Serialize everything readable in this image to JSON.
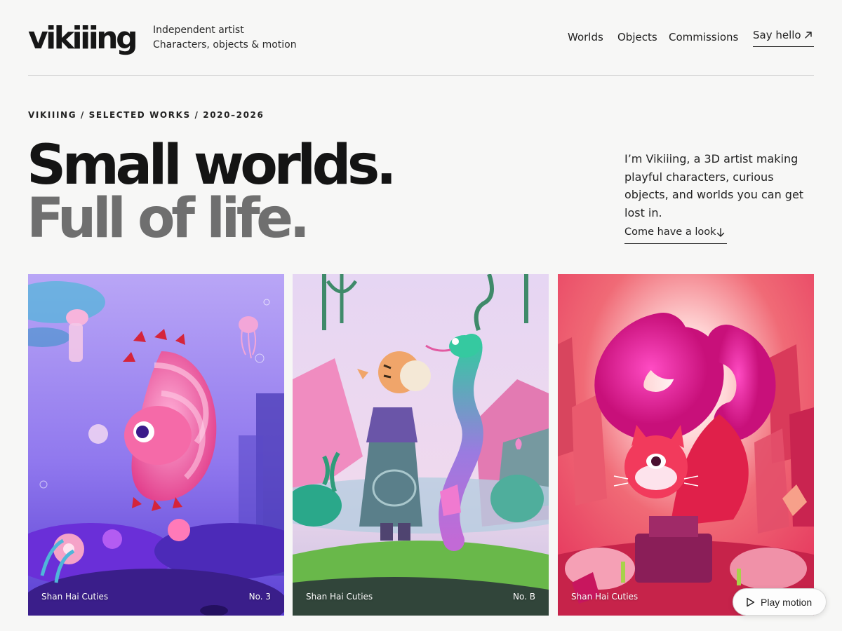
{
  "site": {
    "logo": "vikiiing",
    "tagline_line1": "Independent artist",
    "tagline_line2": "Characters, objects & motion"
  },
  "nav": {
    "items": [
      "Worlds",
      "Objects",
      "Commissions"
    ],
    "cta": "Say hello",
    "cta_icon": "arrow-up-right-icon"
  },
  "hero": {
    "eyebrow": "VIKIIING / SELECTED WORKS / 2020–2026",
    "headline_line1": "Small worlds.",
    "headline_line2": "Full of life.",
    "intro": "I’m Vikiiing, a 3D artist making playful characters, curious objects, and worlds you can get lost in.",
    "link": "Come have a look",
    "link_icon": "arrow-down-icon"
  },
  "works": [
    {
      "series": "Shan Hai Cuties",
      "number": "No. 3",
      "palette": [
        "#8a6cf0",
        "#e860b8"
      ]
    },
    {
      "series": "Shan Hai Cuties",
      "number": "No. B",
      "palette": [
        "#e8d8f6",
        "#3fc7a0"
      ]
    },
    {
      "series": "Shan Hai Cuties",
      "number": "",
      "palette": [
        "#f04a5a",
        "#e8208a"
      ]
    }
  ],
  "play": {
    "label": "Play motion",
    "icon": "play-icon"
  },
  "colors": {
    "background": "#f7f7f6",
    "text": "#1a1a1a",
    "muted_headline": "#6f6f6f"
  }
}
